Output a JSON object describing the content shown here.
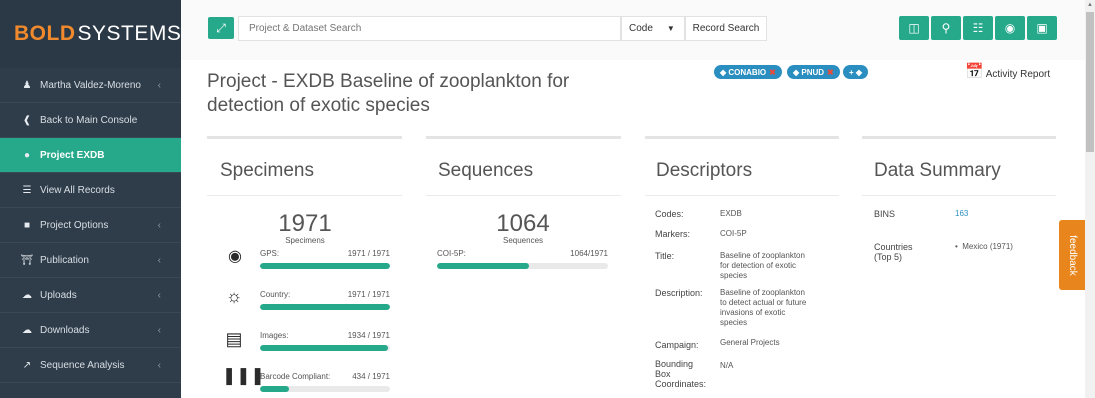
{
  "brand": {
    "part1": "BOLD",
    "part2": "SYSTEMS"
  },
  "sidebar": {
    "items": [
      {
        "label": "Martha Valdez-Moreno",
        "icon": "user-icon",
        "chevron": "‹"
      },
      {
        "label": "Back to Main Console",
        "icon": "back-circle-icon"
      },
      {
        "label": "Project EXDB",
        "icon": "map-marker-icon",
        "active": true
      },
      {
        "label": "View All Records",
        "icon": "list-icon"
      },
      {
        "label": "Project Options",
        "icon": "folder-icon",
        "chevron": "‹"
      },
      {
        "label": "Publication",
        "icon": "institution-icon",
        "chevron": "‹"
      },
      {
        "label": "Uploads",
        "icon": "cloud-upload-icon",
        "chevron": "‹"
      },
      {
        "label": "Downloads",
        "icon": "cloud-download-icon",
        "chevron": "‹"
      },
      {
        "label": "Sequence Analysis",
        "icon": "line-chart-icon",
        "chevron": "‹"
      }
    ]
  },
  "topbar": {
    "search_placeholder": "Project & Dataset Search",
    "code_select": "Code",
    "record_search": "Record Search",
    "buttons": [
      "database-icon",
      "search-icon",
      "sitemap-icon",
      "dashboard-icon",
      "book-icon"
    ]
  },
  "header": {
    "title_line1": "Project - EXDB Baseline of zooplankton for",
    "title_line2": "detection of exotic species",
    "tags": [
      "CONABIO",
      "PNUD"
    ],
    "add_tag": "+",
    "activity_report": "Activity Report"
  },
  "specimens": {
    "title": "Specimens",
    "count": "1971",
    "caption": "Specimens",
    "rows": [
      {
        "icon": "map-marker-icon",
        "label": "GPS:",
        "value": "1971 / 1971",
        "fraction": 1.0
      },
      {
        "icon": "globe-icon",
        "label": "Country:",
        "value": "1971 / 1971",
        "fraction": 1.0
      },
      {
        "icon": "image-icon",
        "label": "Images:",
        "value": "1934 / 1971",
        "fraction": 0.981
      },
      {
        "icon": "barcode-icon",
        "label": "Barcode Compliant:",
        "value": "434 / 1971",
        "fraction": 0.22
      }
    ]
  },
  "sequences": {
    "title": "Sequences",
    "count": "1064",
    "caption": "Sequences",
    "rows": [
      {
        "label": "COI-5P:",
        "value": "1064/1971",
        "fraction": 0.54
      }
    ]
  },
  "descriptors": {
    "title": "Descriptors",
    "codes_k": "Codes:",
    "codes_v": "EXDB",
    "markers_k": "Markers:",
    "markers_v": "COI-5P",
    "title_k": "Title:",
    "title_v1": "Baseline of zooplankton",
    "title_v2": "for detection of exotic",
    "title_v3": "species",
    "desc_k": "Description:",
    "desc_v1": "Baseline of zooplankton",
    "desc_v2": "to detect actual or future",
    "desc_v3": "invasions of exotic",
    "desc_v4": "species",
    "campaign_k": "Campaign:",
    "campaign_v": "General Projects",
    "bbox_k1": "Bounding",
    "bbox_k2": "Box",
    "bbox_k3": "Coordinates:",
    "bbox_v": "N/A"
  },
  "data_summary": {
    "title": "Data Summary",
    "bins_k": "BINS",
    "bins_v": "163",
    "countries_k1": "Countries",
    "countries_k2": "(Top 5)",
    "countries_v": "Mexico (1971)"
  },
  "feedback": "feedback",
  "colors": {
    "accent": "#26a88b",
    "sidebar": "#2f3d4b",
    "brand_orange": "#f08a2c",
    "tag_blue": "#2a8fc0",
    "feedback": "#e8861d"
  }
}
